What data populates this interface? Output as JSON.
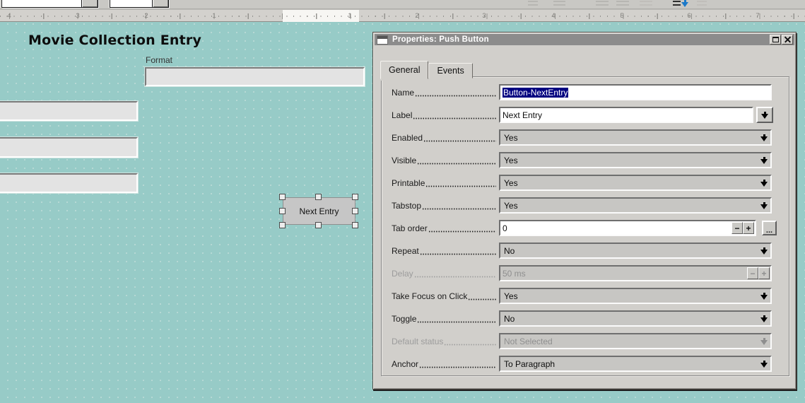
{
  "ruler": {
    "numbers": [
      {
        "label": "4",
        "pos": 13
      },
      {
        "label": "3",
        "pos": 110
      },
      {
        "label": "2",
        "pos": 207
      },
      {
        "label": "1",
        "pos": 303
      },
      {
        "label": "1",
        "pos": 495
      },
      {
        "label": "2",
        "pos": 590
      },
      {
        "label": "3",
        "pos": 685
      },
      {
        "label": "4",
        "pos": 783
      },
      {
        "label": "5",
        "pos": 880
      },
      {
        "label": "6",
        "pos": 975
      },
      {
        "label": "7",
        "pos": 1072
      }
    ]
  },
  "form": {
    "title": "Movie Collection Entry",
    "format_label": "Format",
    "button_label": "Next Entry"
  },
  "dialog": {
    "title": "Properties: Push Button",
    "tabs": [
      {
        "label": "General"
      },
      {
        "label": "Events"
      }
    ],
    "rows": [
      {
        "label": "Name",
        "value": "Button-NextEntry"
      },
      {
        "label": "Label",
        "value": "Next Entry"
      },
      {
        "label": "Enabled",
        "value": "Yes"
      },
      {
        "label": "Visible",
        "value": "Yes"
      },
      {
        "label": "Printable",
        "value": "Yes"
      },
      {
        "label": "Tabstop",
        "value": "Yes"
      },
      {
        "label": "Tab order",
        "value": "0"
      },
      {
        "label": "Repeat",
        "value": "No"
      },
      {
        "label": "Delay",
        "value": "50 ms",
        "disabled": true
      },
      {
        "label": "Take Focus on Click",
        "value": "Yes"
      },
      {
        "label": "Toggle",
        "value": "No"
      },
      {
        "label": "Default status",
        "value": "Not Selected",
        "disabled": true
      },
      {
        "label": "Anchor",
        "value": "To Paragraph"
      }
    ],
    "controls": {
      "minus": "−",
      "plus": "+",
      "more": "..."
    }
  },
  "colors": {
    "canvas_teal": "#97cbc7",
    "dialog_silver": "#d1cfcb",
    "titlebar_gray": "#8c8c8c",
    "selection_blue": "#000080",
    "accent_blue": "#1b79c9"
  }
}
